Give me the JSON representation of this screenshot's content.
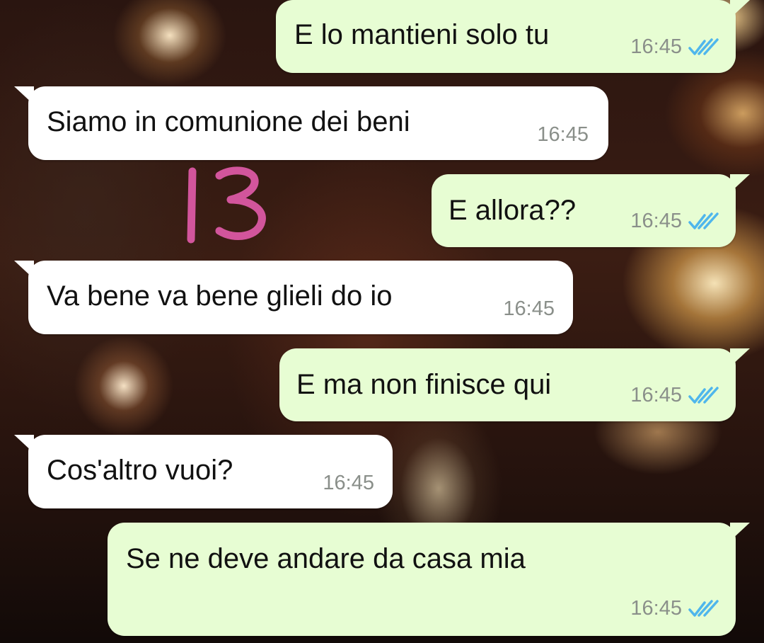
{
  "chat": {
    "annotation": "13",
    "messages": [
      {
        "direction": "outgoing",
        "text": "E lo mantieni solo tu",
        "time": "16:45",
        "status": "read-double-check-icon"
      },
      {
        "direction": "incoming",
        "text": "Siamo in comunione dei beni",
        "time": "16:45"
      },
      {
        "direction": "outgoing",
        "text": "E allora??",
        "time": "16:45",
        "status": "read-double-check-icon"
      },
      {
        "direction": "incoming",
        "text": "Va bene va bene glieli do io",
        "time": "16:45"
      },
      {
        "direction": "outgoing",
        "text": "E ma non finisce qui",
        "time": "16:45",
        "status": "read-double-check-icon"
      },
      {
        "direction": "incoming",
        "text": "Cos'altro vuoi?",
        "time": "16:45"
      },
      {
        "direction": "outgoing",
        "text": "Se ne deve andare da casa mia",
        "time": "16:45",
        "status": "read-double-check-icon"
      }
    ]
  },
  "colors": {
    "outgoing_bubble": "#e7fdd3",
    "incoming_bubble": "#ffffff",
    "read_ticks": "#4fb6ec",
    "annotation_ink": "#d2559c",
    "timestamp": "#8a8f8a"
  }
}
